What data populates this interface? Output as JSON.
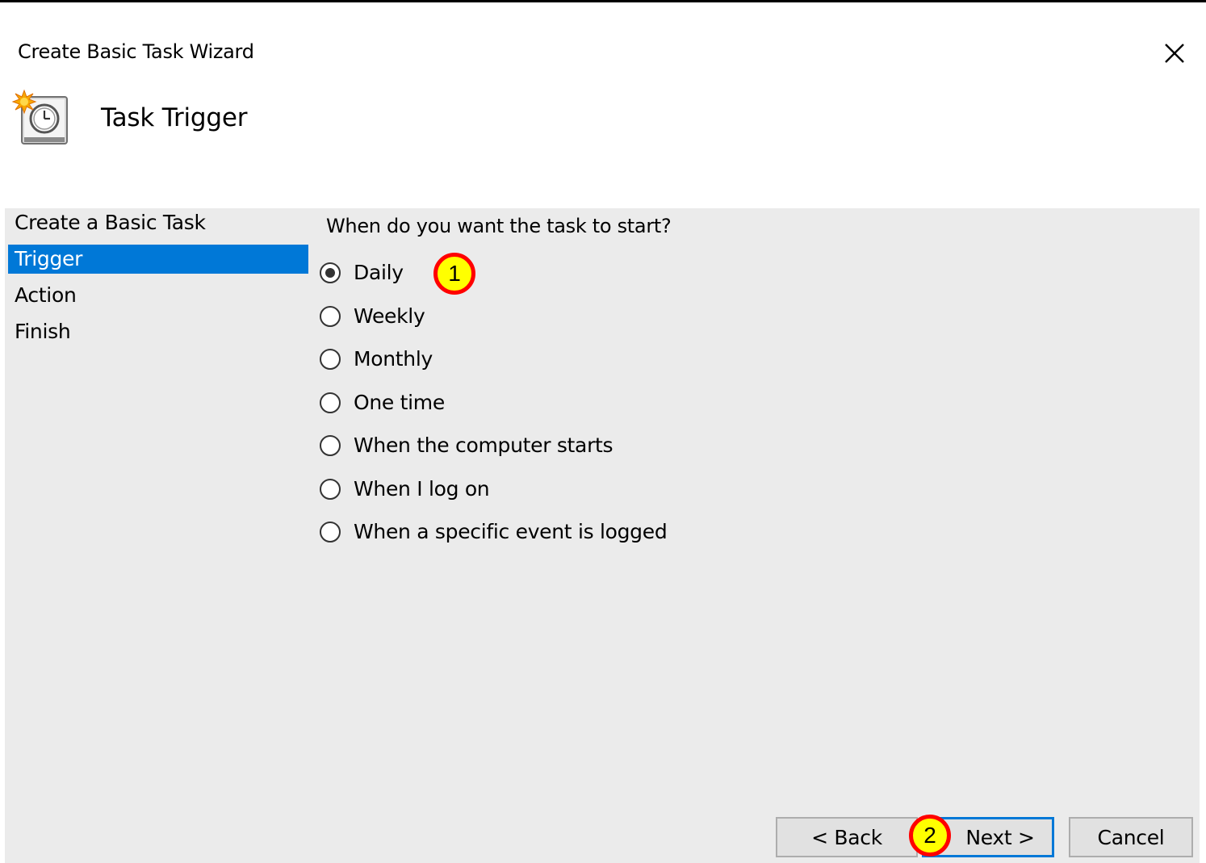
{
  "window": {
    "title": "Create Basic Task Wizard",
    "close_icon": "close-icon"
  },
  "header": {
    "title": "Task Trigger",
    "icon": "task-scheduler-clock-icon"
  },
  "steps": [
    {
      "label": "Create a Basic Task",
      "active": false
    },
    {
      "label": "Trigger",
      "active": true
    },
    {
      "label": "Action",
      "active": false
    },
    {
      "label": "Finish",
      "active": false
    }
  ],
  "prompt": "When do you want the task to start?",
  "trigger_options": [
    {
      "label": "Daily",
      "selected": true
    },
    {
      "label": "Weekly",
      "selected": false
    },
    {
      "label": "Monthly",
      "selected": false
    },
    {
      "label": "One time",
      "selected": false
    },
    {
      "label": "When the computer starts",
      "selected": false
    },
    {
      "label": "When I log on",
      "selected": false
    },
    {
      "label": "When a specific event is logged",
      "selected": false
    }
  ],
  "buttons": {
    "back": "< Back",
    "next": "Next >",
    "cancel": "Cancel"
  },
  "annotations": {
    "marker1": "1",
    "marker2": "2"
  },
  "colors": {
    "accent": "#0078d7",
    "marker_fill": "#ffff00",
    "marker_border": "#ff0000",
    "panel_background": "#ebebeb"
  }
}
